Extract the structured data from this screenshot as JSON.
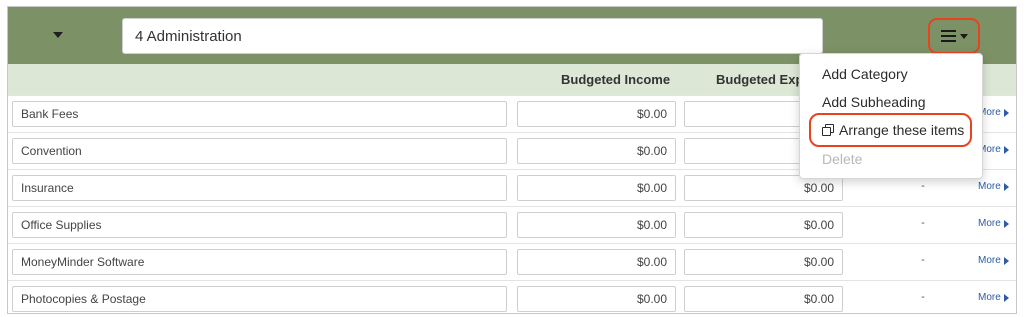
{
  "header": {
    "category_value": "4 Administration"
  },
  "columns": {
    "budgeted_income": "Budgeted Income",
    "budgeted_expense": "Budgeted Exp"
  },
  "rows": [
    {
      "name": "Bank Fees",
      "income": "$0.00",
      "expense": "",
      "remaining": "",
      "more": "More"
    },
    {
      "name": "Convention",
      "income": "$0.00",
      "expense": "",
      "remaining": "",
      "more": "More"
    },
    {
      "name": "Insurance",
      "income": "$0.00",
      "expense": "$0.00",
      "remaining": "-",
      "more": "More"
    },
    {
      "name": "Office Supplies",
      "income": "$0.00",
      "expense": "$0.00",
      "remaining": "-",
      "more": "More"
    },
    {
      "name": "MoneyMinder Software",
      "income": "$0.00",
      "expense": "$0.00",
      "remaining": "-",
      "more": "More"
    },
    {
      "name": "Photocopies & Postage",
      "income": "$0.00",
      "expense": "$0.00",
      "remaining": "-",
      "more": "More"
    }
  ],
  "menu": {
    "items": [
      "Add Category",
      "Add Subheading",
      "Arrange these items",
      "Delete"
    ],
    "disabled": [
      "Delete"
    ]
  },
  "colors": {
    "header_bg": "#7d9166",
    "column_header_bg": "#dde7d6",
    "highlight": "#e8431f",
    "link": "#2a5caa"
  },
  "icons": {
    "collapse": "caret-down-icon",
    "menu": "hamburger-menu-icon",
    "arrange": "copy-icon",
    "more": "caret-right-icon"
  }
}
